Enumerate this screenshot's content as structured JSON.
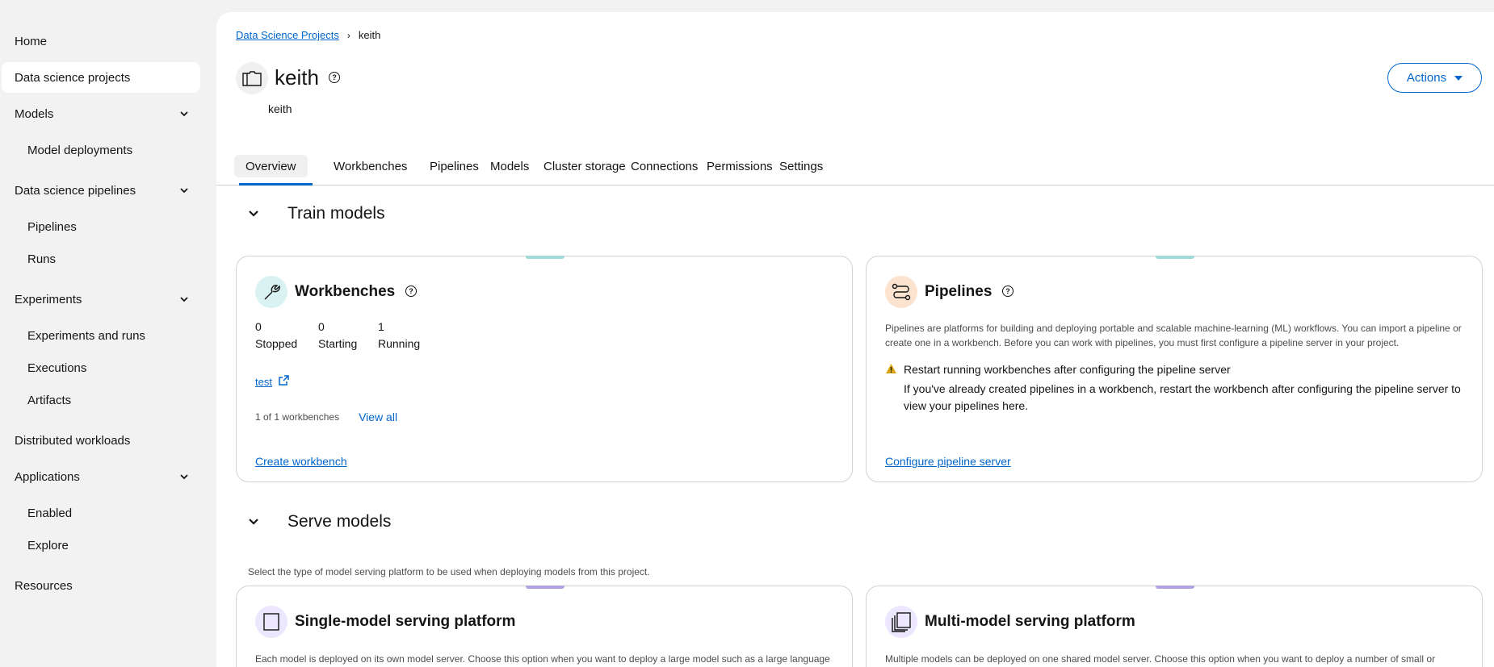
{
  "sidebar": {
    "items": [
      {
        "label": "Home"
      },
      {
        "label": "Data science projects"
      },
      {
        "label": "Models"
      },
      {
        "label": "Model deployments"
      },
      {
        "label": "Data science pipelines"
      },
      {
        "label": "Pipelines"
      },
      {
        "label": "Runs"
      },
      {
        "label": "Experiments"
      },
      {
        "label": "Experiments and runs"
      },
      {
        "label": "Executions"
      },
      {
        "label": "Artifacts"
      },
      {
        "label": "Distributed workloads"
      },
      {
        "label": "Applications"
      },
      {
        "label": "Enabled"
      },
      {
        "label": "Explore"
      },
      {
        "label": "Resources"
      }
    ]
  },
  "breadcrumb": {
    "parent": "Data Science Projects",
    "separator": "›",
    "current": "keith"
  },
  "project": {
    "title": "keith",
    "subtitle": "keith",
    "help": "?"
  },
  "actions": {
    "label": "Actions"
  },
  "tabs": [
    "Overview",
    "Workbenches",
    "Pipelines",
    "Models",
    "Cluster storage",
    "Connections",
    "Permissions",
    "Settings"
  ],
  "train": {
    "heading": "Train models",
    "workbenches": {
      "title": "Workbenches",
      "stats": [
        {
          "value": "0",
          "label": "Stopped"
        },
        {
          "value": "0",
          "label": "Starting"
        },
        {
          "value": "1",
          "label": "Running"
        }
      ],
      "item_link": "test",
      "count_text": "1 of 1 workbenches",
      "view_all": "View all",
      "create": "Create workbench"
    },
    "pipelines": {
      "title": "Pipelines",
      "description": "Pipelines are platforms for building and deploying portable and scalable machine-learning (ML) workflows. You can import a pipeline or create one in a workbench. Before you can work with pipelines, you must first configure a pipeline server in your project.",
      "warning_title": "Restart running workbenches after configuring the pipeline server",
      "warning_body": "If you've already created pipelines in a workbench, restart the workbench after configuring the pipeline server to view your pipelines here.",
      "configure": "Configure pipeline server"
    }
  },
  "serve": {
    "heading": "Serve models",
    "description": "Select the type of model serving platform to be used when deploying models from this project.",
    "single": {
      "title": "Single-model serving platform",
      "description": "Each model is deployed on its own model server. Choose this option when you want to deploy a large model such as a large language"
    },
    "multi": {
      "title": "Multi-model serving platform",
      "description": "Multiple models can be deployed on one shared model server. Choose this option when you want to deploy a number of small or"
    }
  },
  "colors": {
    "accent": "#0066cc",
    "teal": "#a2d9d9",
    "purple": "#b2a3e0",
    "warning": "#dca614"
  }
}
